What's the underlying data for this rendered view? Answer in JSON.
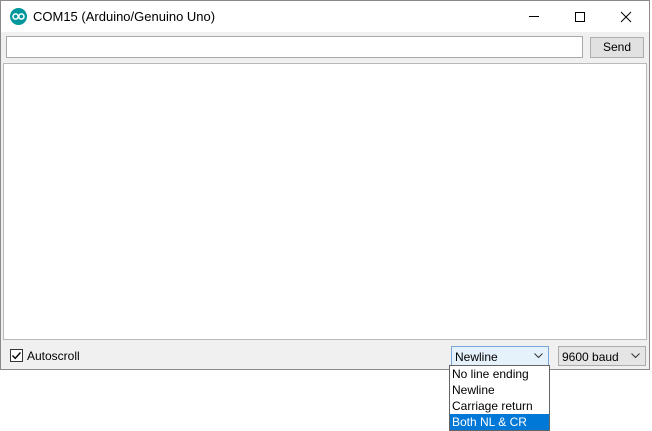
{
  "window": {
    "title": "COM15 (Arduino/Genuino Uno)",
    "icon": "arduino-logo-icon"
  },
  "send_row": {
    "input_value": "",
    "send_label": "Send"
  },
  "output": {
    "text": ""
  },
  "status_bar": {
    "autoscroll_label": "Autoscroll",
    "autoscroll_checked": true,
    "line_ending_selected": "Newline",
    "baud_selected": "9600 baud"
  },
  "line_ending_dropdown": {
    "options": [
      "No line ending",
      "Newline",
      "Carriage return",
      "Both NL & CR"
    ],
    "highlighted": "Both NL & CR"
  },
  "colors": {
    "arduino_teal": "#00979c",
    "highlight": "#0078d7",
    "combo_focus_bg": "#e5f1fb"
  }
}
